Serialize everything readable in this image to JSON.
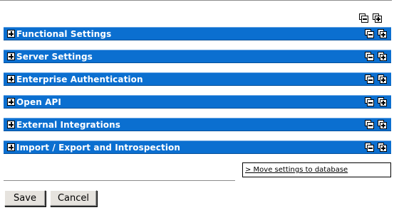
{
  "global_controls": {
    "collapse_all_icon": "collapse-all-icon",
    "expand_all_icon": "expand-all-icon"
  },
  "sections": [
    {
      "title": "Functional Settings"
    },
    {
      "title": "Server Settings"
    },
    {
      "title": "Enterprise Authentication"
    },
    {
      "title": "Open API"
    },
    {
      "title": "External Integrations"
    },
    {
      "title": "Import / Export and Introspection"
    }
  ],
  "move_link": "> Move settings to database",
  "buttons": {
    "save": "Save",
    "cancel": "Cancel"
  },
  "colors": {
    "section_bar": "#0b6fd0",
    "section_text": "#ffffff"
  }
}
